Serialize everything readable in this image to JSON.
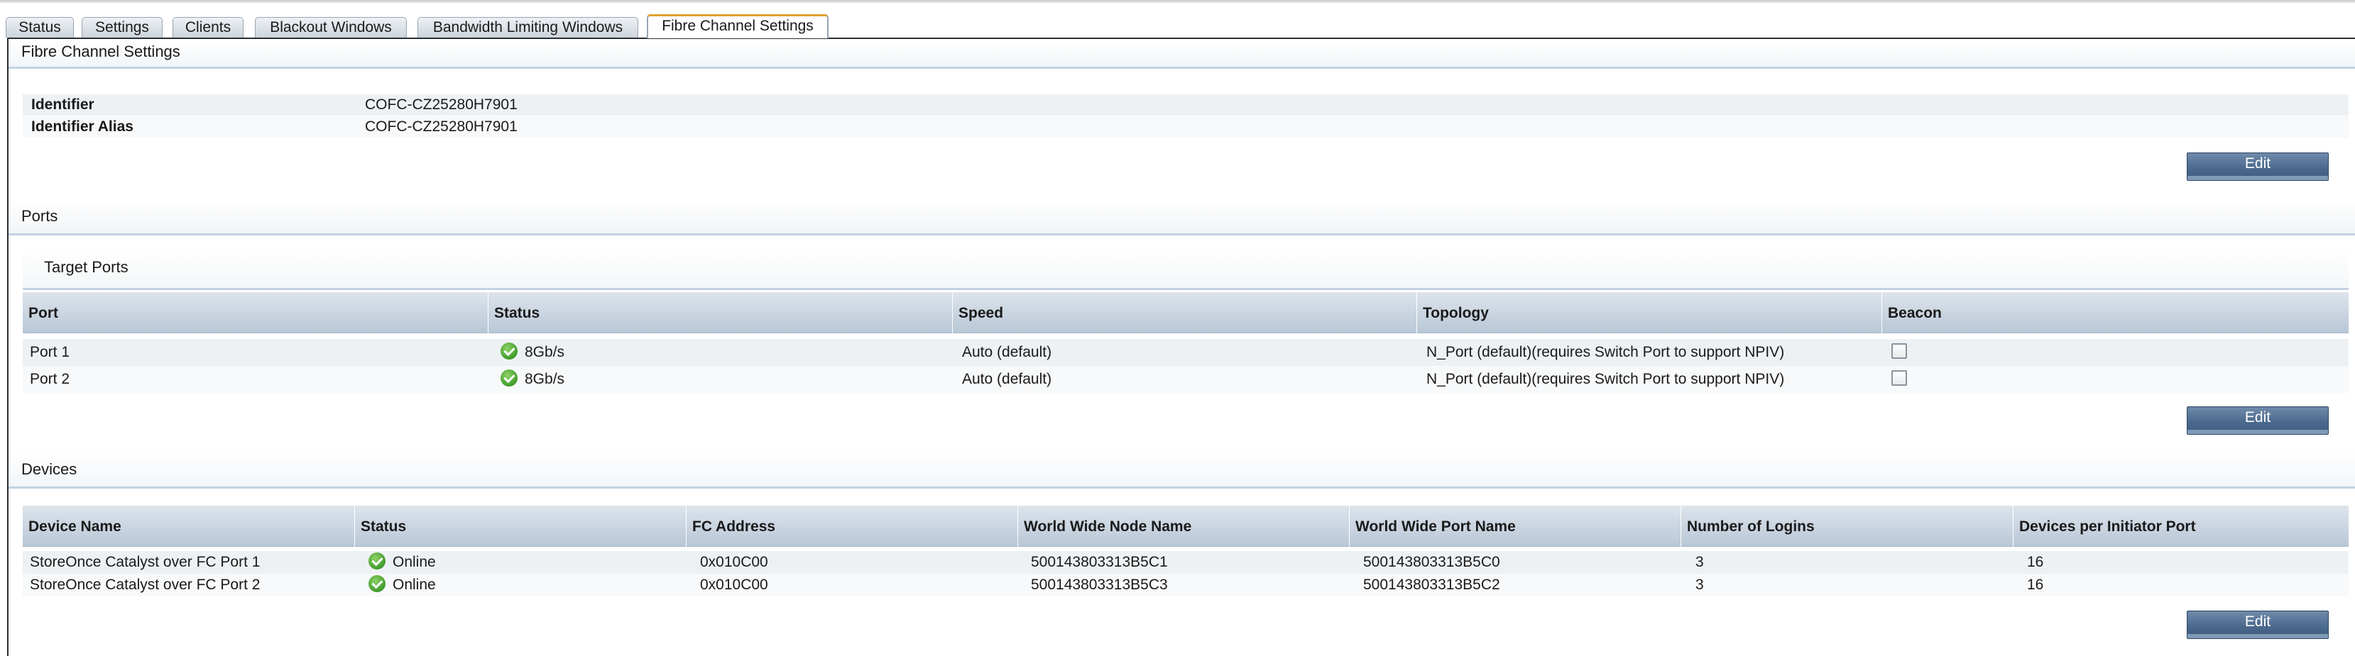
{
  "tabs": [
    {
      "label": "Status"
    },
    {
      "label": "Settings"
    },
    {
      "label": "Clients"
    },
    {
      "label": "Blackout Windows"
    },
    {
      "label": "Bandwidth Limiting Windows"
    },
    {
      "label": "Fibre Channel Settings",
      "active": true
    }
  ],
  "fibre_channel": {
    "title": "Fibre Channel Settings",
    "identifier_label": "Identifier",
    "identifier_value": "COFC-CZ25280H7901",
    "alias_label": "Identifier Alias",
    "alias_value": "COFC-CZ25280H7901",
    "edit_label": "Edit"
  },
  "ports": {
    "title": "Ports",
    "panel_title": "Target Ports",
    "columns": [
      "Port",
      "Status",
      "Speed",
      "Topology",
      "Beacon"
    ],
    "rows": [
      {
        "port": "Port 1",
        "status_icon": "online-check-icon",
        "status": "8Gb/s",
        "speed": "Auto (default)",
        "topology": "N_Port (default)(requires Switch Port to support NPIV)",
        "beacon": false
      },
      {
        "port": "Port 2",
        "status_icon": "online-check-icon",
        "status": "8Gb/s",
        "speed": "Auto (default)",
        "topology": "N_Port (default)(requires Switch Port to support NPIV)",
        "beacon": false
      }
    ],
    "edit_label": "Edit"
  },
  "devices": {
    "title": "Devices",
    "columns": [
      "Device Name",
      "Status",
      "FC Address",
      "World Wide Node Name",
      "World Wide Port Name",
      "Number of Logins",
      "Devices per Initiator Port"
    ],
    "rows": [
      {
        "name": "StoreOnce Catalyst over FC Port 1",
        "status_icon": "online-check-icon",
        "status": "Online",
        "fc_address": "0x010C00",
        "wwnn": "500143803313B5C1",
        "wwpn": "500143803313B5C0",
        "logins": "3",
        "per_port": "16"
      },
      {
        "name": "StoreOnce Catalyst over FC Port 2",
        "status_icon": "online-check-icon",
        "status": "Online",
        "fc_address": "0x010C00",
        "wwnn": "500143803313B5C3",
        "wwpn": "500143803313B5C2",
        "logins": "3",
        "per_port": "16"
      }
    ],
    "edit_label": "Edit"
  },
  "colors": {
    "active_tab_accent": "#e0a030",
    "button": "#4c6a8e",
    "status_ok": "#3f9b2a"
  }
}
